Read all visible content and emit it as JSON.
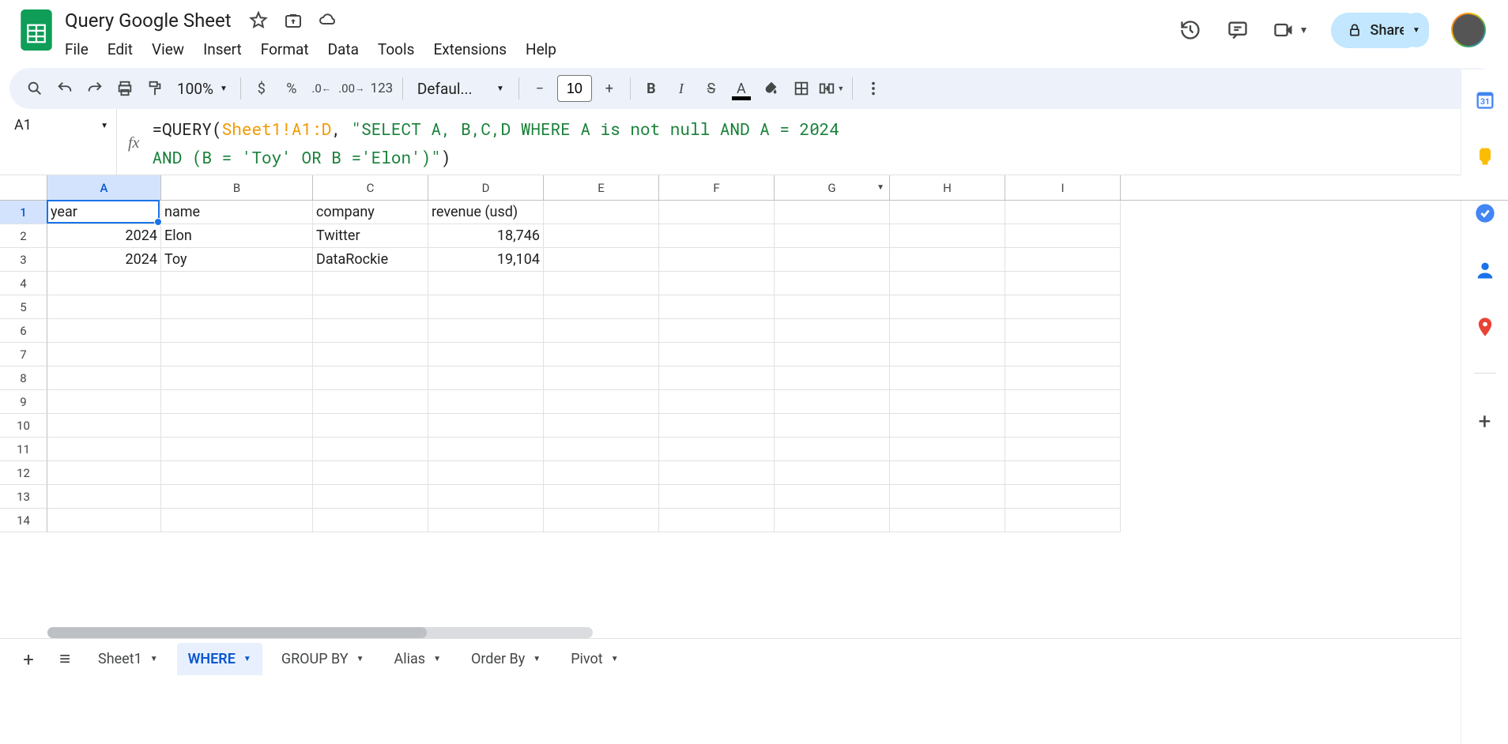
{
  "doc": {
    "title": "Query Google Sheet"
  },
  "menu": {
    "file": "File",
    "edit": "Edit",
    "view": "View",
    "insert": "Insert",
    "format": "Format",
    "data": "Data",
    "tools": "Tools",
    "extensions": "Extensions",
    "help": "Help"
  },
  "header": {
    "share": "Share"
  },
  "toolbar": {
    "zoom": "100%",
    "font": "Defaul...",
    "size": "10",
    "fmt123": "123"
  },
  "namebox": "A1",
  "formula": {
    "prefix": "=QUERY(",
    "range": "Sheet1!A1:D",
    "mid": ", ",
    "str1": "\"SELECT A, B,C,D WHERE A is not null AND A = 2024",
    "str2": "AND (B = 'Toy' OR B ='Elon')\"",
    "suffix": ")"
  },
  "cols": [
    "A",
    "B",
    "C",
    "D",
    "E",
    "F",
    "G",
    "H",
    "I"
  ],
  "rows": [
    "1",
    "2",
    "3",
    "4",
    "5",
    "6",
    "7",
    "8",
    "9",
    "10",
    "11",
    "12",
    "13",
    "14"
  ],
  "data": {
    "headers": {
      "A": "year",
      "B": "name",
      "C": "company",
      "D": "revenue (usd)"
    },
    "r2": {
      "A": "2024",
      "B": "Elon",
      "C": "Twitter",
      "D": "18,746"
    },
    "r3": {
      "A": "2024",
      "B": "Toy",
      "C": "DataRockie",
      "D": "19,104"
    }
  },
  "tabs": {
    "sheet1": "Sheet1",
    "where": "WHERE",
    "groupby": "GROUP BY",
    "alias": "Alias",
    "orderby": "Order By",
    "pivot": "Pivot"
  }
}
